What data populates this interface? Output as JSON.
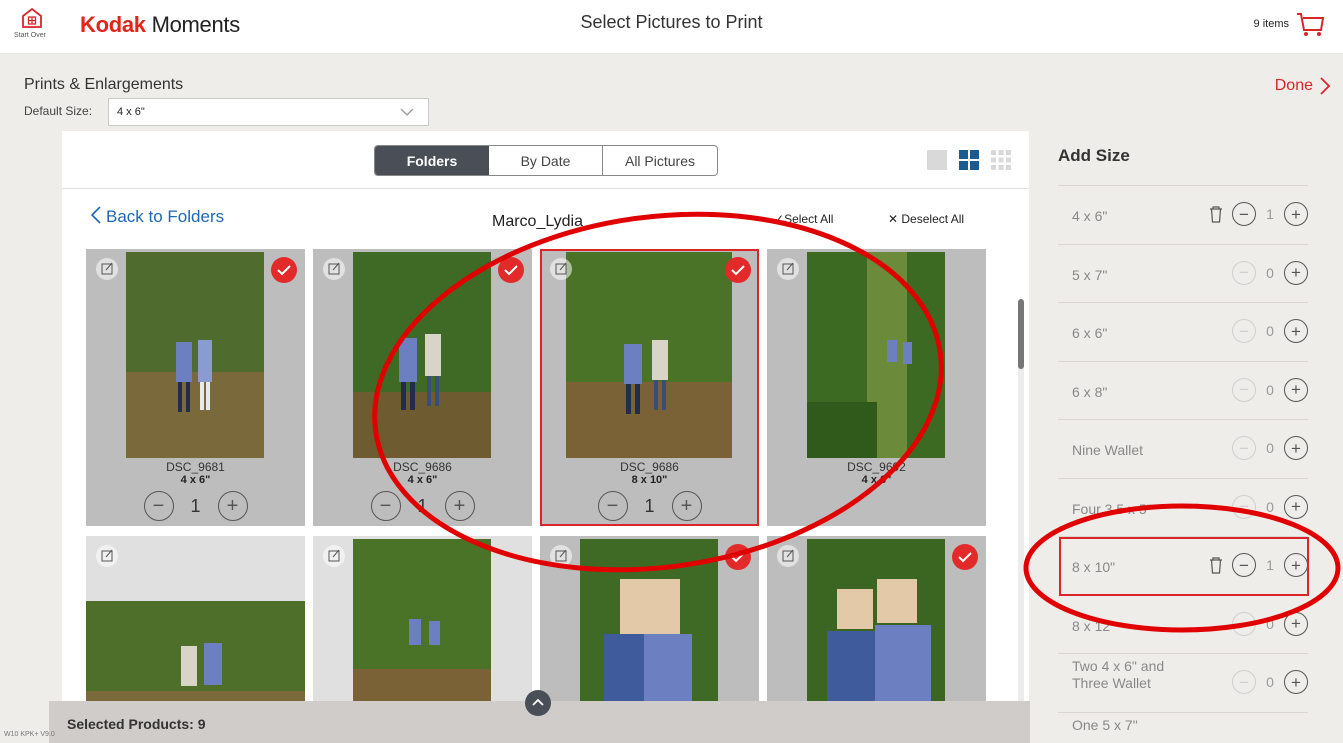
{
  "header": {
    "home_label": "Start Over",
    "brand_kodak": "Kodak",
    "brand_moments": "Moments",
    "title": "Select Pictures to Print",
    "cart_count": "9 items"
  },
  "colors": {
    "accent": "#d8262b",
    "segment_active": "#4a4e57",
    "link": "#1e67b5"
  },
  "main": {
    "section_title": "Prints & Enlargements",
    "default_size_label": "Default Size:",
    "default_size_value": "4 x 6\"",
    "tabs": [
      {
        "label": "Folders",
        "active": true
      },
      {
        "label": "By Date",
        "active": false
      },
      {
        "label": "All Pictures",
        "active": false
      }
    ],
    "back_label": "Back to Folders",
    "folder_name": "Marco_Lydia",
    "select_all": "Select All",
    "deselect_all": "Deselect All",
    "photos": [
      {
        "filename": "DSC_9681",
        "size": "4 x 6\"",
        "qty": "1",
        "checked": true
      },
      {
        "filename": "DSC_9686",
        "size": "4 x 6\"",
        "qty": "1",
        "checked": true
      },
      {
        "filename": "DSC_9686",
        "size": "8 x 10\"",
        "qty": "1",
        "checked": true
      },
      {
        "filename": "DSC_9692",
        "size": "4 x 6\"",
        "qty": "",
        "checked": false
      },
      {
        "filename": "",
        "size": "",
        "qty": "",
        "checked": false
      },
      {
        "filename": "",
        "size": "",
        "qty": "",
        "checked": false
      },
      {
        "filename": "",
        "size": "",
        "qty": "",
        "checked": true
      },
      {
        "filename": "",
        "size": "",
        "qty": "",
        "checked": true
      }
    ],
    "selected_products": "Selected Products: 9",
    "version": "W10 KPK+ V9.0"
  },
  "sidebar": {
    "done_label": "Done",
    "add_size_title": "Add Size",
    "sizes": [
      {
        "name": "4 x 6\"",
        "qty": "1"
      },
      {
        "name": "5 x 7\"",
        "qty": "0"
      },
      {
        "name": "6 x 6\"",
        "qty": "0"
      },
      {
        "name": "6 x 8\"",
        "qty": "0"
      },
      {
        "name": "Nine Wallet",
        "qty": "0"
      },
      {
        "name": "Four 3.5 x 5\"",
        "qty": "0"
      },
      {
        "name": "8 x 10\"",
        "qty": "1"
      },
      {
        "name": "8 x 12\"",
        "qty": "0"
      },
      {
        "name": "Two 4 x 6\" and Three Wallet",
        "qty": "0"
      },
      {
        "name": "One 5 x 7\"",
        "qty": ""
      }
    ]
  }
}
